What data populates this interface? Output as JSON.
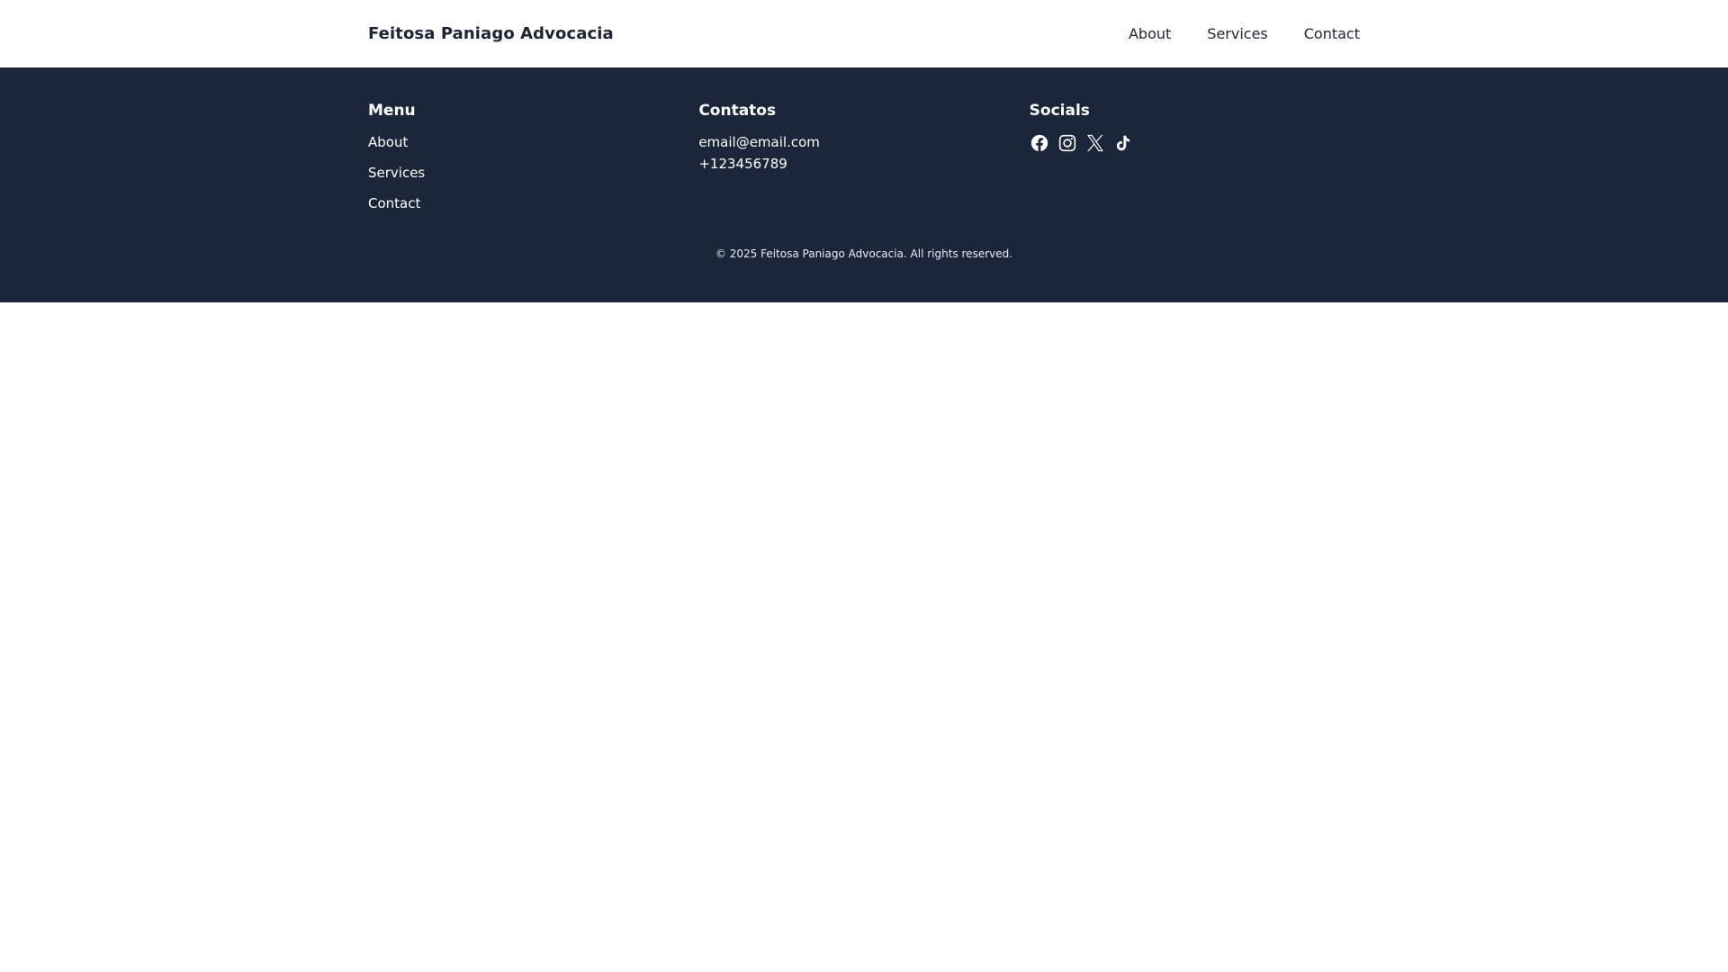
{
  "header": {
    "brand": "Feitosa Paniago Advocacia",
    "nav": [
      {
        "label": "About"
      },
      {
        "label": "Services"
      },
      {
        "label": "Contact"
      }
    ]
  },
  "footer": {
    "menu": {
      "heading": "Menu",
      "links": [
        {
          "label": "About"
        },
        {
          "label": "Services"
        },
        {
          "label": "Contact"
        }
      ]
    },
    "contacts": {
      "heading": "Contatos",
      "email": "email@email.com",
      "phone": "+123456789"
    },
    "socials": {
      "heading": "Socials",
      "icons": [
        "facebook-icon",
        "instagram-icon",
        "x-icon",
        "tiktok-icon"
      ]
    },
    "copyright": "© 2025 Feitosa Paniago Advocacia. All rights reserved."
  },
  "colors": {
    "footer_bg": "#1c263a",
    "text_dark": "#1c2434",
    "text_light": "#ffffff"
  }
}
